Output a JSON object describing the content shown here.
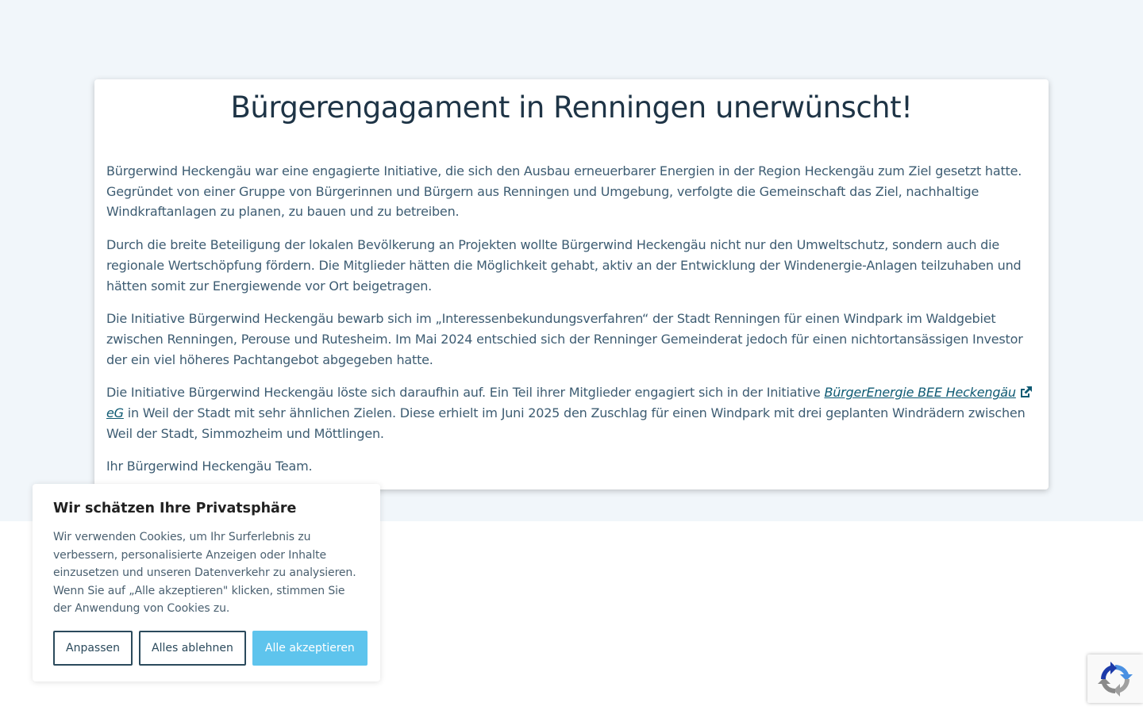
{
  "article": {
    "title": "Bürgerengagament in Renningen unerwünscht!",
    "paragraphs": [
      "Bürgerwind Heckengäu war eine engagierte Initiative, die sich den Ausbau erneuerbarer Energien in der Region Heckengäu zum Ziel gesetzt hatte. Gegründet von einer Gruppe von Bürgerinnen und Bürgern aus Renningen und Umgebung, verfolgte die Gemeinschaft das Ziel, nachhaltige Windkraftanlagen zu planen, zu bauen und zu betreiben.",
      "Durch die breite Beteiligung der lokalen Bevölkerung an Projekten wollte Bürgerwind Heckengäu nicht nur den Umweltschutz, sondern auch die regionale Wertschöpfung fördern. Die Mitglieder hätten die Möglichkeit gehabt, aktiv an der Entwicklung der Windenergie-Anlagen teilzuhaben und hätten somit zur Energiewende vor Ort beigetragen.",
      "Die Initiative Bürgerwind Heckengäu bewarb sich im „Interessenbekundungsverfahren“ der Stadt Renningen für einen Windpark im Waldgebiet zwischen Renningen, Perouse und Rutesheim. Im Mai 2024 entschied sich der Renninger Gemeinderat jedoch für einen nichtortansässigen Investor der ein viel höheres Pachtangebot abgegeben hatte."
    ],
    "paragraph4": {
      "before_link": "Die Initiative Bürgerwind Heckengäu löste sich daraufhin auf. Ein Teil ihrer Mitglieder engagiert sich in der Initiative ",
      "link_text": "BürgerEnergie BEE Heckengäu",
      "link_suffix": "eG",
      "after_link": " in Weil der Stadt mit sehr ähnlichen Zielen. Diese erhielt im Juni 2025 den Zuschlag für einen Windpark mit drei geplanten Windrädern zwischen Weil der Stadt, Simmozheim und Möttlingen."
    },
    "signature": "Ihr Bürgerwind Heckengäu Team."
  },
  "cookie_banner": {
    "title": "Wir schätzen Ihre Privatsphäre",
    "description": "Wir verwenden Cookies, um Ihr Surferlebnis zu verbessern, personalisierte Anzeigen oder Inhalte einzusetzen und unseren Datenverkehr zu analysieren. Wenn Sie auf „Alle akzeptieren\" klicken, stimmen Sie der Anwendung von Cookies zu.",
    "buttons": {
      "customize": "Anpassen",
      "reject_all": "Alles ablehnen",
      "accept_all": "Alle akzeptieren"
    }
  },
  "icons": {
    "external_link": "external-link-icon",
    "recaptcha": "recaptcha-icon"
  },
  "colors": {
    "page_background": "#f1f6fa",
    "title_text": "#1e3446",
    "body_text": "#3d5c72",
    "link": "#0f5a73",
    "accept_button": "#5ec4ed",
    "outline_button": "#2b4a5c"
  }
}
